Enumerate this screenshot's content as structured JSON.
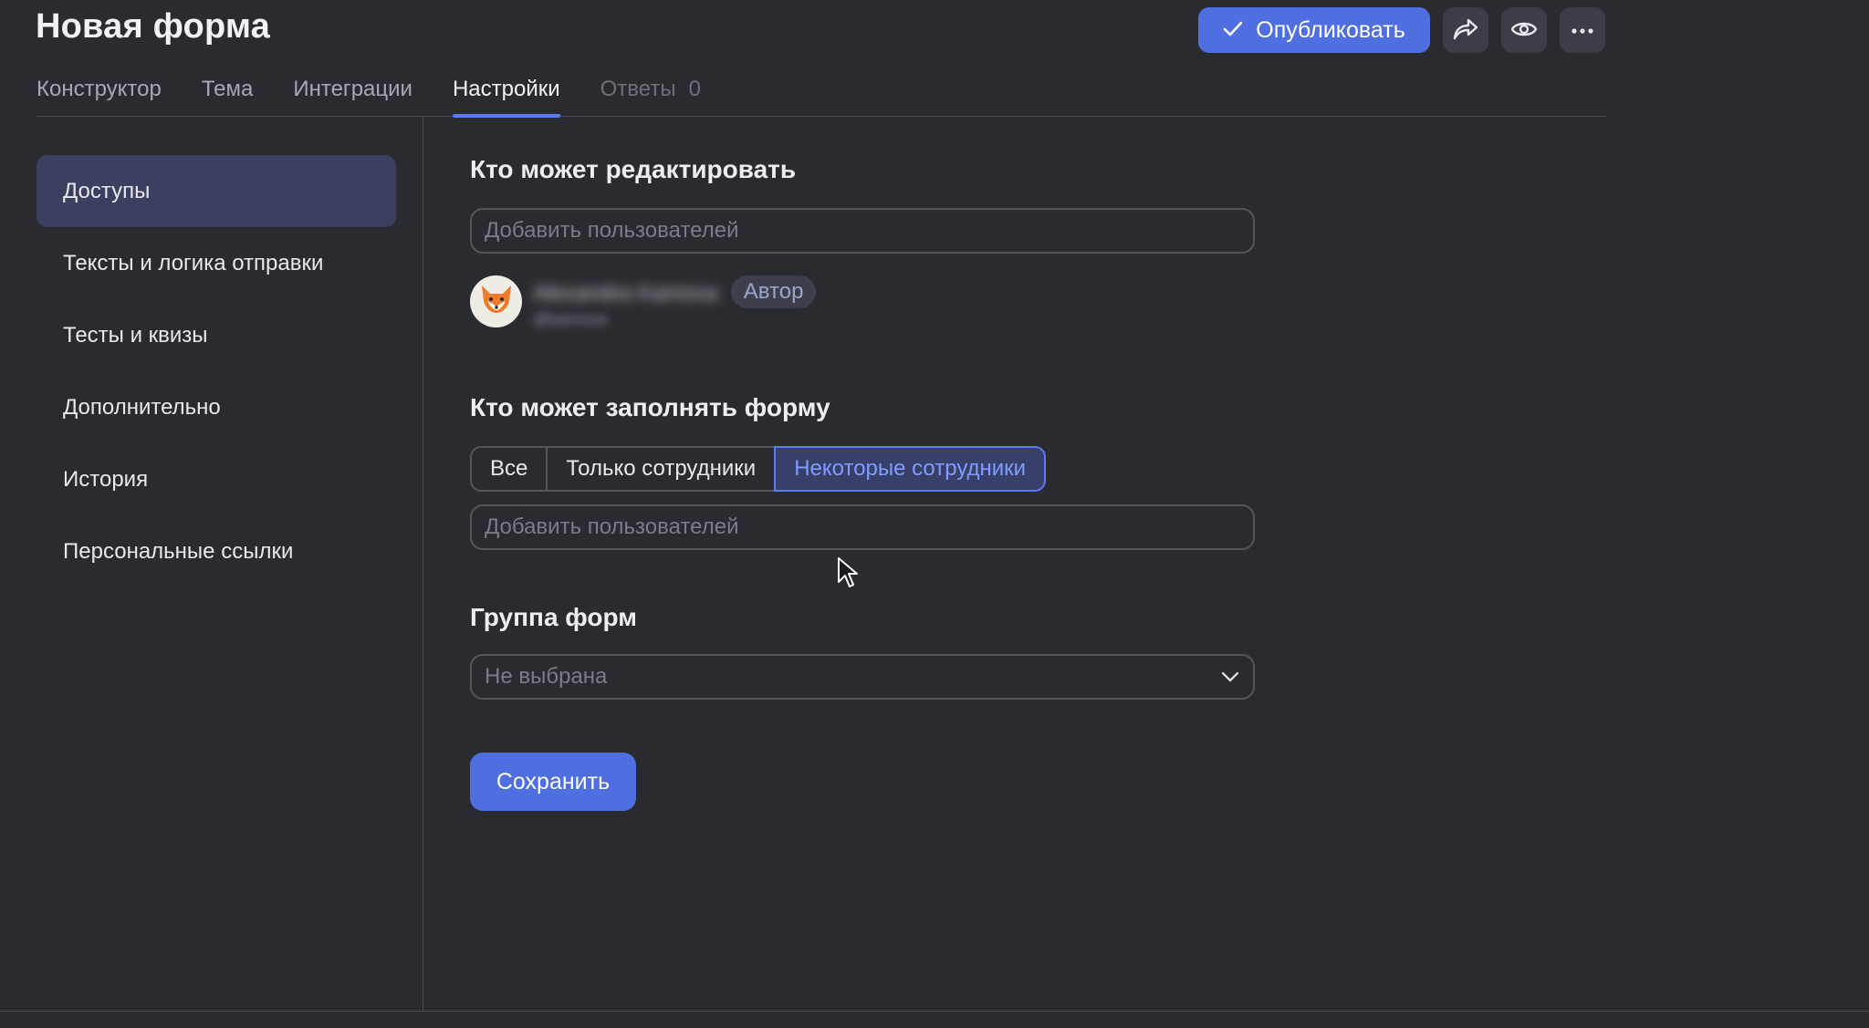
{
  "header": {
    "title": "Новая форма",
    "publish_label": "Опубликовать",
    "icons": [
      "check-icon",
      "share-icon",
      "eye-icon",
      "more-icon"
    ]
  },
  "tabs": [
    {
      "label": "Конструктор"
    },
    {
      "label": "Тема"
    },
    {
      "label": "Интеграции"
    },
    {
      "label": "Настройки",
      "active": true
    },
    {
      "label": "Ответы",
      "count": "0",
      "muted": true
    }
  ],
  "sidebar": {
    "items": [
      {
        "label": "Доступы",
        "active": true
      },
      {
        "label": "Тексты и логика отправки"
      },
      {
        "label": "Тесты и квизы"
      },
      {
        "label": "Дополнительно"
      },
      {
        "label": "История"
      },
      {
        "label": "Персональные ссылки"
      }
    ]
  },
  "editors": {
    "title": "Кто может редактировать",
    "placeholder": "Добавить пользователей",
    "user": {
      "name": "Alexandra Kamova",
      "login": "@kamova",
      "role": "Автор",
      "avatar_icon": "fox-icon"
    }
  },
  "fillers": {
    "title": "Кто может заполнять форму",
    "options": [
      "Все",
      "Только сотрудники",
      "Некоторые сотрудники"
    ],
    "selected_index": 2,
    "placeholder": "Добавить пользователей"
  },
  "form_group": {
    "title": "Группа форм",
    "value": "Не выбрана"
  },
  "save_label": "Сохранить",
  "colors": {
    "background": "#2a2a31",
    "accent": "#4f6fe0",
    "selected_segment_text": "#7f9cff"
  }
}
